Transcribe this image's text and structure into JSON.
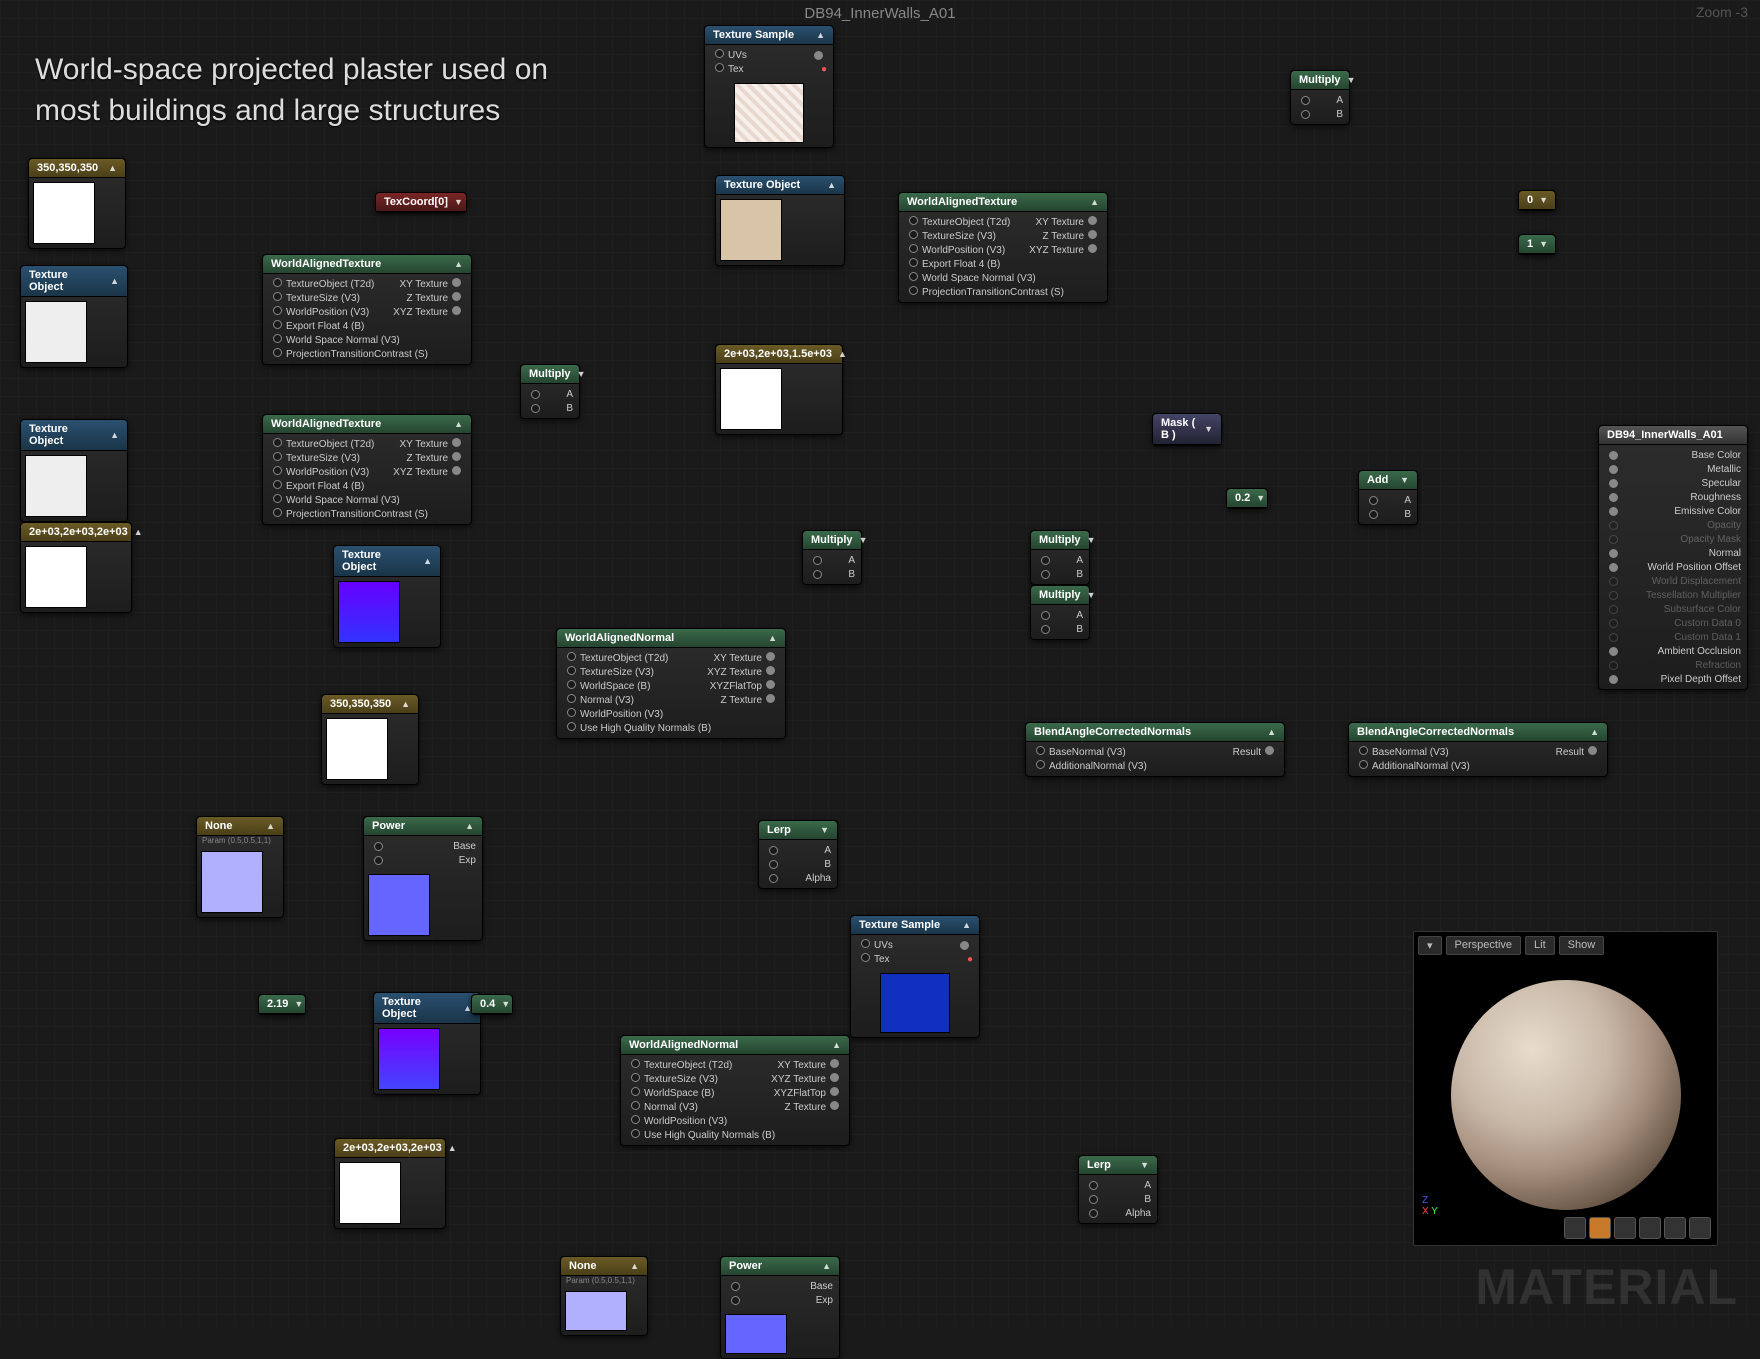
{
  "header": {
    "title": "DB94_InnerWalls_A01",
    "zoom": "Zoom -3"
  },
  "overlay": "World-space projected plaster used on most buildings and large structures",
  "watermark": "MATERIAL",
  "wat": {
    "inputs": [
      "TextureObject (T2d)",
      "TextureSize (V3)",
      "WorldPosition (V3)",
      "Export Float 4 (B)",
      "World Space Normal (V3)",
      "ProjectionTransitionContrast (S)"
    ],
    "outputs": [
      "XY Texture",
      "Z Texture",
      "XYZ Texture"
    ]
  },
  "wan": {
    "inputs": [
      "TextureObject (T2d)",
      "TextureSize (V3)",
      "WorldSpace (B)",
      "Normal (V3)",
      "WorldPosition (V3)",
      "Use High Quality Normals (B)"
    ],
    "outputs": [
      "XY Texture",
      "XYZ Texture",
      "XYZFlatTop",
      "Z Texture"
    ]
  },
  "bacn": {
    "title": "BlendAngleCorrectedNormals",
    "inputs": [
      "BaseNormal (V3)",
      "AdditionalNormal (V3)"
    ],
    "output": "Result"
  },
  "labels": {
    "texSample": "Texture Sample",
    "texObject": "Texture Object",
    "wat": "WorldAlignedTexture",
    "wan": "WorldAlignedNormal",
    "mult": "Multiply",
    "lerp": "Lerp",
    "add": "Add",
    "power": "Power",
    "mask": "Mask ( B )",
    "texcoord": "TexCoord[0]",
    "none": "None",
    "uvs": "UVs",
    "tex": "Tex",
    "a": "A",
    "b": "B",
    "alpha": "Alpha",
    "base": "Base",
    "exp": "Exp",
    "param": "Param (0.5,0.5,1,1)"
  },
  "consts": {
    "c350": "350,350,350",
    "c2e3a": "2e+03,2e+03,2e+03",
    "c2e3b": "2e+03,2e+03,1.5e+03",
    "c2e3c": "2e+03,2e+03,2e+03",
    "c0": "0",
    "c1": "1",
    "c02": "0.2",
    "c219": "2.19",
    "c04": "0.4"
  },
  "material": {
    "title": "DB94_InnerWalls_A01",
    "pins": [
      "Base Color",
      "Metallic",
      "Specular",
      "Roughness",
      "Emissive Color",
      "Opacity",
      "Opacity Mask",
      "Normal",
      "World Position Offset",
      "World Displacement",
      "Tessellation Multiplier",
      "Subsurface Color",
      "Custom Data 0",
      "Custom Data 1",
      "Ambient Occlusion",
      "Refraction",
      "Pixel Depth Offset"
    ]
  },
  "preview": {
    "persp": "Perspective",
    "lit": "Lit",
    "show": "Show"
  }
}
